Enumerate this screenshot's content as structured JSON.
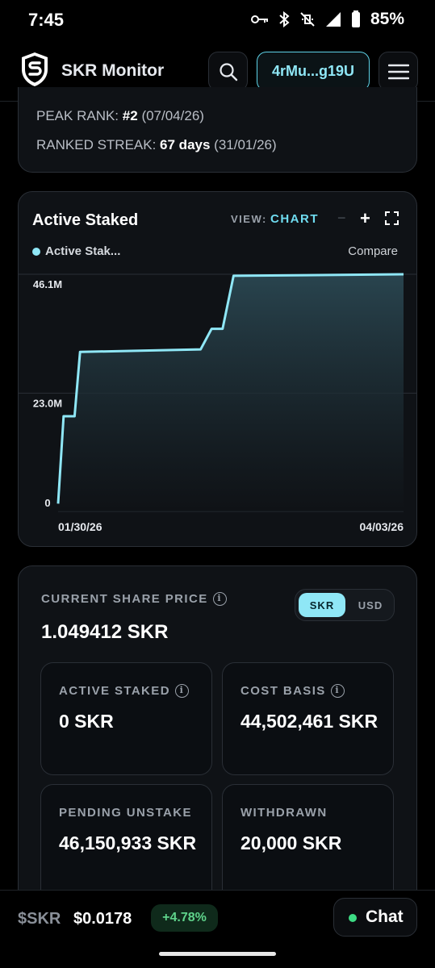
{
  "status_bar": {
    "time": "7:45",
    "battery": "85%",
    "icons": [
      "key-icon",
      "bluetooth-icon",
      "vibrate-off-icon",
      "signal-icon",
      "battery-icon"
    ]
  },
  "header": {
    "app_title": "SKR Monitor",
    "wallet_label": "4rMu...g19U",
    "icons": [
      "shield-s-logo",
      "search-icon",
      "hamburger-menu-icon"
    ]
  },
  "rank": {
    "peak_label": "PEAK RANK:",
    "peak_value": "#2",
    "peak_date": "(07/04/26)",
    "streak_label": "RANKED STREAK:",
    "streak_value": "67 days",
    "streak_date": "(31/01/26)"
  },
  "chart_card": {
    "title": "Active Staked",
    "view_label": "VIEW:",
    "view_value": "CHART",
    "zoom_out": "−",
    "zoom_in": "+",
    "legend_label": "Active Stak...",
    "compare_label": "Compare",
    "colors": {
      "line": "#8fe7f6",
      "fill_top": "#2c4a55",
      "fill_bottom": "#0f1216"
    }
  },
  "chart_data": {
    "type": "area",
    "x": [
      "01/30/26",
      "01/31/26",
      "02/02/26",
      "02/03/26",
      "02/25/26",
      "02/27/26",
      "03/01/26",
      "03/03/26",
      "04/03/26"
    ],
    "series": [
      {
        "values": [
          1.5,
          18.5,
          18.5,
          31.0,
          31.5,
          35.5,
          35.5,
          45.8,
          46.1
        ]
      }
    ],
    "xtick_labels": [
      "01/30/26",
      "04/03/26"
    ],
    "ytick_labels": [
      "46.1M",
      "23.0M",
      "0"
    ],
    "yticks": [
      46.1,
      23.0,
      0
    ],
    "ylim": [
      0,
      46.1
    ],
    "grid": true
  },
  "share_price": {
    "label": "CURRENT SHARE PRICE",
    "value": "1.049412 SKR",
    "toggle_skr": "SKR",
    "toggle_usd": "USD",
    "selected": "SKR",
    "info": "i"
  },
  "stats": [
    {
      "label": "ACTIVE STAKED",
      "value": "0 SKR",
      "has_info": true
    },
    {
      "label": "COST BASIS",
      "value": "44,502,461 SKR",
      "has_info": true
    },
    {
      "label": "PENDING UNSTAKE",
      "value": "46,150,933 SKR",
      "has_info": false
    },
    {
      "label": "WITHDRAWN",
      "value": "20,000 SKR",
      "has_info": false
    }
  ],
  "ticker": {
    "symbol": "$SKR",
    "price": "$0.0178",
    "change": "+4.78%",
    "chat_label": "Chat"
  }
}
